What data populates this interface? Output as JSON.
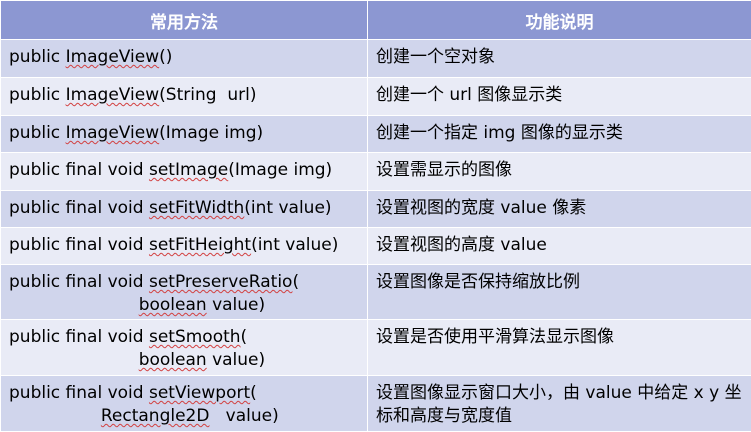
{
  "header": {
    "col_method": "常用方法",
    "col_desc": "功能说明"
  },
  "rows": [
    {
      "prefix": "public ",
      "name": "ImageView",
      "suffix": "()",
      "cont_pre": "",
      "cont_word": "",
      "cont_post": "",
      "desc": "创建一个空对象"
    },
    {
      "prefix": "public ",
      "name": "ImageView",
      "suffix": "(String  url)",
      "cont_pre": "",
      "cont_word": "",
      "cont_post": "",
      "desc": "创建一个 url 图像显示类"
    },
    {
      "prefix": "public ",
      "name": "ImageView",
      "suffix": "(Image img)",
      "cont_pre": "",
      "cont_word": "",
      "cont_post": "",
      "desc": "创建一个指定 img 图像的显示类"
    },
    {
      "prefix": "public final void ",
      "name": "setImage",
      "suffix": "(Image img)",
      "cont_pre": "",
      "cont_word": "",
      "cont_post": "",
      "desc": "设置需显示的图像"
    },
    {
      "prefix": "public final void ",
      "name": "setFitWidth",
      "suffix": "(int value)",
      "cont_pre": "",
      "cont_word": "",
      "cont_post": "",
      "desc": "设置视图的宽度 value 像素"
    },
    {
      "prefix": "public final void ",
      "name": "setFitHeight",
      "suffix": "(int value)",
      "cont_pre": "",
      "cont_word": "",
      "cont_post": "",
      "desc": "设置视图的高度 value"
    },
    {
      "prefix": "public final void ",
      "name": "setPreserveRatio",
      "suffix": "(",
      "cont_pre": "                        ",
      "cont_word": "boolean",
      "cont_post": " value)",
      "desc": "设置图像是否保持缩放比例"
    },
    {
      "prefix": "public final void ",
      "name": "setSmooth",
      "suffix": "(",
      "cont_pre": "                        ",
      "cont_word": "boolean",
      "cont_post": " value)",
      "desc": "设置是否使用平滑算法显示图像"
    },
    {
      "prefix": "public final void ",
      "name": "setViewport",
      "suffix": "(",
      "cont_pre": "                 ",
      "cont_word": "Rectangle2D",
      "cont_post": "   value)",
      "desc": "设置图像显示窗口大小，由 value 中给定 x y 坐标和高度与宽度值"
    }
  ]
}
